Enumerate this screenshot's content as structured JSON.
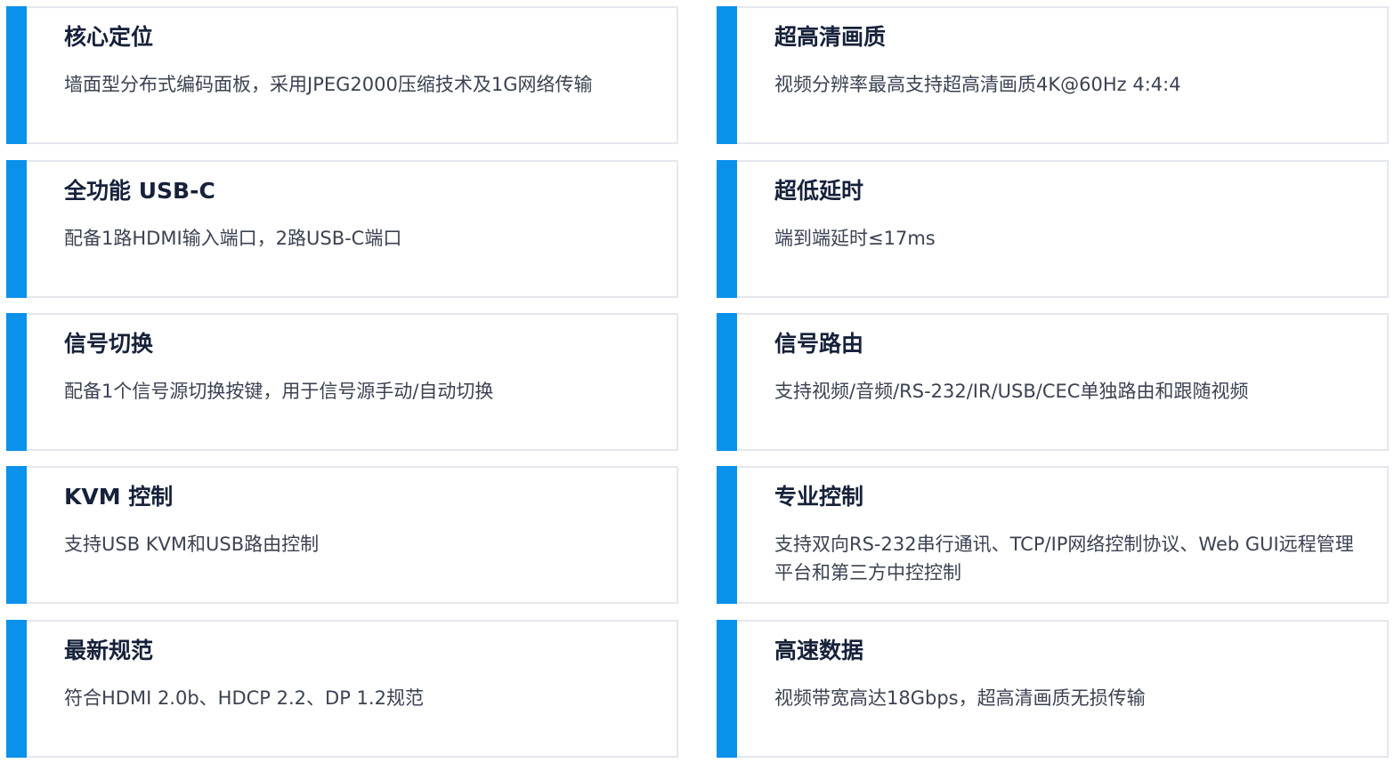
{
  "accent_color": "#0a91ea",
  "border_color": "#e4e7ed",
  "features": [
    {
      "title": "核心定位",
      "desc": "墙面型分布式编码面板，采用JPEG2000压缩技术及1G网络传输"
    },
    {
      "title": "超高清画质",
      "desc": "视频分辨率最高支持超高清画质4K@60Hz 4:4:4"
    },
    {
      "title": "全功能 USB-C",
      "desc": "配备1路HDMI输入端口，2路USB-C端口"
    },
    {
      "title": "超低延时",
      "desc": "端到端延时≤17ms"
    },
    {
      "title": "信号切换",
      "desc": "配备1个信号源切换按键，用于信号源手动/自动切换"
    },
    {
      "title": "信号路由",
      "desc": "支持视频/音频/RS-232/IR/USB/CEC单独路由和跟随视频"
    },
    {
      "title": "KVM 控制",
      "desc": "支持USB KVM和USB路由控制"
    },
    {
      "title": "专业控制",
      "desc": "支持双向RS-232串行通讯、TCP/IP网络控制协议、Web GUI远程管理平台和第三方中控控制"
    },
    {
      "title": "最新规范",
      "desc": "符合HDMI 2.0b、HDCP 2.2、DP 1.2规范"
    },
    {
      "title": "高速数据",
      "desc": "视频带宽高达18Gbps，超高清画质无损传输"
    }
  ]
}
